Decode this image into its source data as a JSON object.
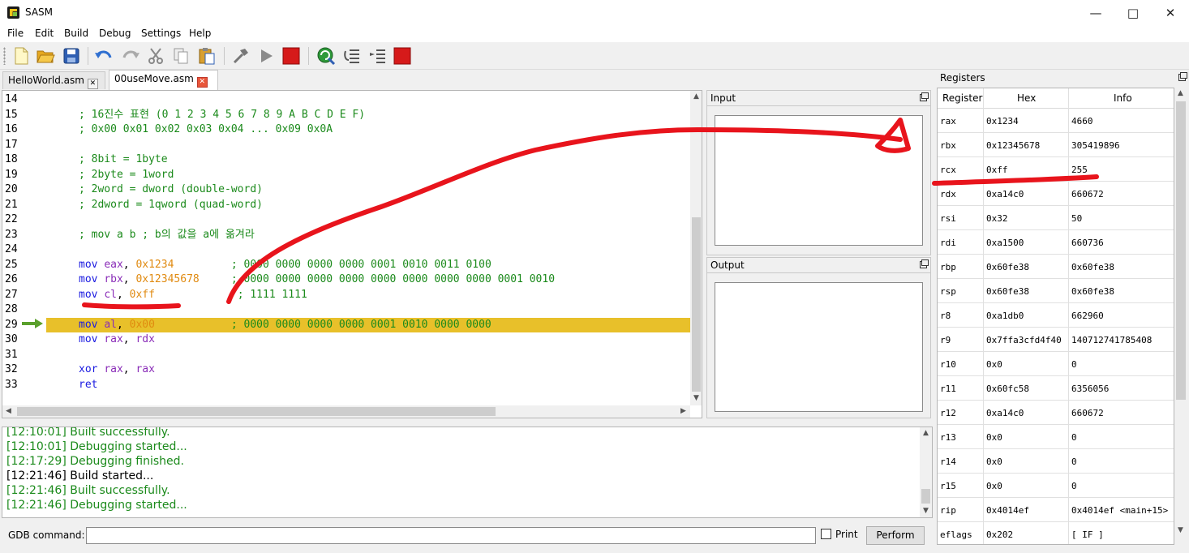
{
  "window": {
    "title": "SASM"
  },
  "menu": [
    "File",
    "Edit",
    "Build",
    "Debug",
    "Settings",
    "Help"
  ],
  "toolbar": [
    "new-file-icon",
    "open-folder-icon",
    "save-icon",
    "undo-icon",
    "redo-icon",
    "cut-icon",
    "copy-icon",
    "paste-icon",
    "build-hammer-icon",
    "run-icon",
    "stop-icon",
    "debug-icon",
    "step-over-icon",
    "step-into-icon",
    "debug-stop-icon"
  ],
  "tabs": [
    {
      "label": "HelloWorld.asm"
    },
    {
      "label": "00useMove.asm"
    }
  ],
  "editor": {
    "lines": [
      {
        "n": "14",
        "parts": []
      },
      {
        "n": "15",
        "parts": [
          {
            "c": "cm",
            "t": "; 16진수 표현 (0 1 2 3 4 5 6 7 8 9 A B C D E F)"
          }
        ]
      },
      {
        "n": "16",
        "parts": [
          {
            "c": "cm",
            "t": "; 0x00 0x01 0x02 0x03 0x04 ... 0x09 0x0A"
          }
        ]
      },
      {
        "n": "17",
        "parts": []
      },
      {
        "n": "18",
        "parts": [
          {
            "c": "cm",
            "t": "; 8bit = 1byte"
          }
        ]
      },
      {
        "n": "19",
        "parts": [
          {
            "c": "cm",
            "t": "; 2byte = 1word"
          }
        ]
      },
      {
        "n": "20",
        "parts": [
          {
            "c": "cm",
            "t": "; 2word = dword (double-word)"
          }
        ]
      },
      {
        "n": "21",
        "parts": [
          {
            "c": "cm",
            "t": "; 2dword = 1qword (quad-word)"
          }
        ]
      },
      {
        "n": "22",
        "parts": []
      },
      {
        "n": "23",
        "parts": [
          {
            "c": "cm",
            "t": "; mov a b ; b의 값을 a에 옮겨라"
          }
        ]
      },
      {
        "n": "24",
        "parts": []
      },
      {
        "n": "25",
        "parts": [
          {
            "c": "kw",
            "t": "mov "
          },
          {
            "c": "reg",
            "t": "eax"
          },
          {
            "c": "",
            "t": ", "
          },
          {
            "c": "num",
            "t": "0x1234"
          },
          {
            "c": "",
            "t": "         "
          },
          {
            "c": "cm",
            "t": "; 0000 0000 0000 0000 0001 0010 0011 0100"
          }
        ]
      },
      {
        "n": "26",
        "parts": [
          {
            "c": "kw",
            "t": "mov "
          },
          {
            "c": "reg",
            "t": "rbx"
          },
          {
            "c": "",
            "t": ", "
          },
          {
            "c": "num",
            "t": "0x12345678"
          },
          {
            "c": "",
            "t": "     "
          },
          {
            "c": "cm",
            "t": "; 0000 0000 0000 0000 0000 0000 0000 0000 0001 0010"
          }
        ]
      },
      {
        "n": "27",
        "parts": [
          {
            "c": "kw",
            "t": "mov "
          },
          {
            "c": "reg",
            "t": "cl"
          },
          {
            "c": "",
            "t": ", "
          },
          {
            "c": "num",
            "t": "0xff"
          },
          {
            "c": "",
            "t": "             "
          },
          {
            "c": "cm",
            "t": "; 1111 1111"
          }
        ]
      },
      {
        "n": "28",
        "parts": []
      },
      {
        "n": "29",
        "parts": [
          {
            "c": "kw",
            "t": "mov "
          },
          {
            "c": "reg",
            "t": "al"
          },
          {
            "c": "",
            "t": ", "
          },
          {
            "c": "num",
            "t": "0x00"
          },
          {
            "c": "",
            "t": "            "
          },
          {
            "c": "cm",
            "t": "; 0000 0000 0000 0000 0001 0010 0000 0000"
          }
        ]
      },
      {
        "n": "30",
        "parts": [
          {
            "c": "kw",
            "t": "mov "
          },
          {
            "c": "reg",
            "t": "rax"
          },
          {
            "c": "",
            "t": ", "
          },
          {
            "c": "reg",
            "t": "rdx"
          }
        ]
      },
      {
        "n": "31",
        "parts": []
      },
      {
        "n": "32",
        "parts": [
          {
            "c": "kw",
            "t": "xor "
          },
          {
            "c": "reg",
            "t": "rax"
          },
          {
            "c": "",
            "t": ", "
          },
          {
            "c": "reg",
            "t": "rax"
          }
        ]
      },
      {
        "n": "33",
        "parts": [
          {
            "c": "kw",
            "t": "ret"
          }
        ]
      }
    ],
    "current_line": "29"
  },
  "input_panel": {
    "title": "Input"
  },
  "output_panel": {
    "title": "Output"
  },
  "log": [
    {
      "t": "[12:10:01] Built successfully.",
      "color": "#1b8a1b"
    },
    {
      "t": "[12:10:01] Debugging started...",
      "color": "#1b8a1b"
    },
    {
      "t": "[12:17:29] Debugging finished.",
      "color": "#1b8a1b"
    },
    {
      "t": "[12:21:46] Build started...",
      "color": "#000000"
    },
    {
      "t": "[12:21:46] Built successfully.",
      "color": "#1b8a1b"
    },
    {
      "t": "[12:21:46] Debugging started...",
      "color": "#1b8a1b"
    }
  ],
  "gdb": {
    "label": "GDB command:",
    "value": "",
    "print_label": "Print",
    "perform_label": "Perform"
  },
  "registers": {
    "title": "Registers",
    "headers": [
      "Register",
      "Hex",
      "Info"
    ],
    "rows": [
      [
        "rax",
        "0x1234",
        "4660"
      ],
      [
        "rbx",
        "0x12345678",
        "305419896"
      ],
      [
        "rcx",
        "0xff",
        "255"
      ],
      [
        "rdx",
        "0xa14c0",
        "660672"
      ],
      [
        "rsi",
        "0x32",
        "50"
      ],
      [
        "rdi",
        "0xa1500",
        "660736"
      ],
      [
        "rbp",
        "0x60fe38",
        "0x60fe38"
      ],
      [
        "rsp",
        "0x60fe38",
        "0x60fe38"
      ],
      [
        "r8",
        "0xa1db0",
        "662960"
      ],
      [
        "r9",
        "0x7ffa3cfd4f40",
        "140712741785408"
      ],
      [
        "r10",
        "0x0",
        "0"
      ],
      [
        "r11",
        "0x60fc58",
        "6356056"
      ],
      [
        "r12",
        "0xa14c0",
        "660672"
      ],
      [
        "r13",
        "0x0",
        "0"
      ],
      [
        "r14",
        "0x0",
        "0"
      ],
      [
        "r15",
        "0x0",
        "0"
      ],
      [
        "rip",
        "0x4014ef",
        "0x4014ef <main+15>"
      ],
      [
        "eflags",
        "0x202",
        "[ IF ]"
      ]
    ]
  },
  "colors": {
    "highlight": "#e8c02a",
    "annotation": "#e8141c",
    "keyword": "#1a1ae0",
    "register": "#8a2db8",
    "number": "#e08a10",
    "comment": "#1b8a1b"
  }
}
